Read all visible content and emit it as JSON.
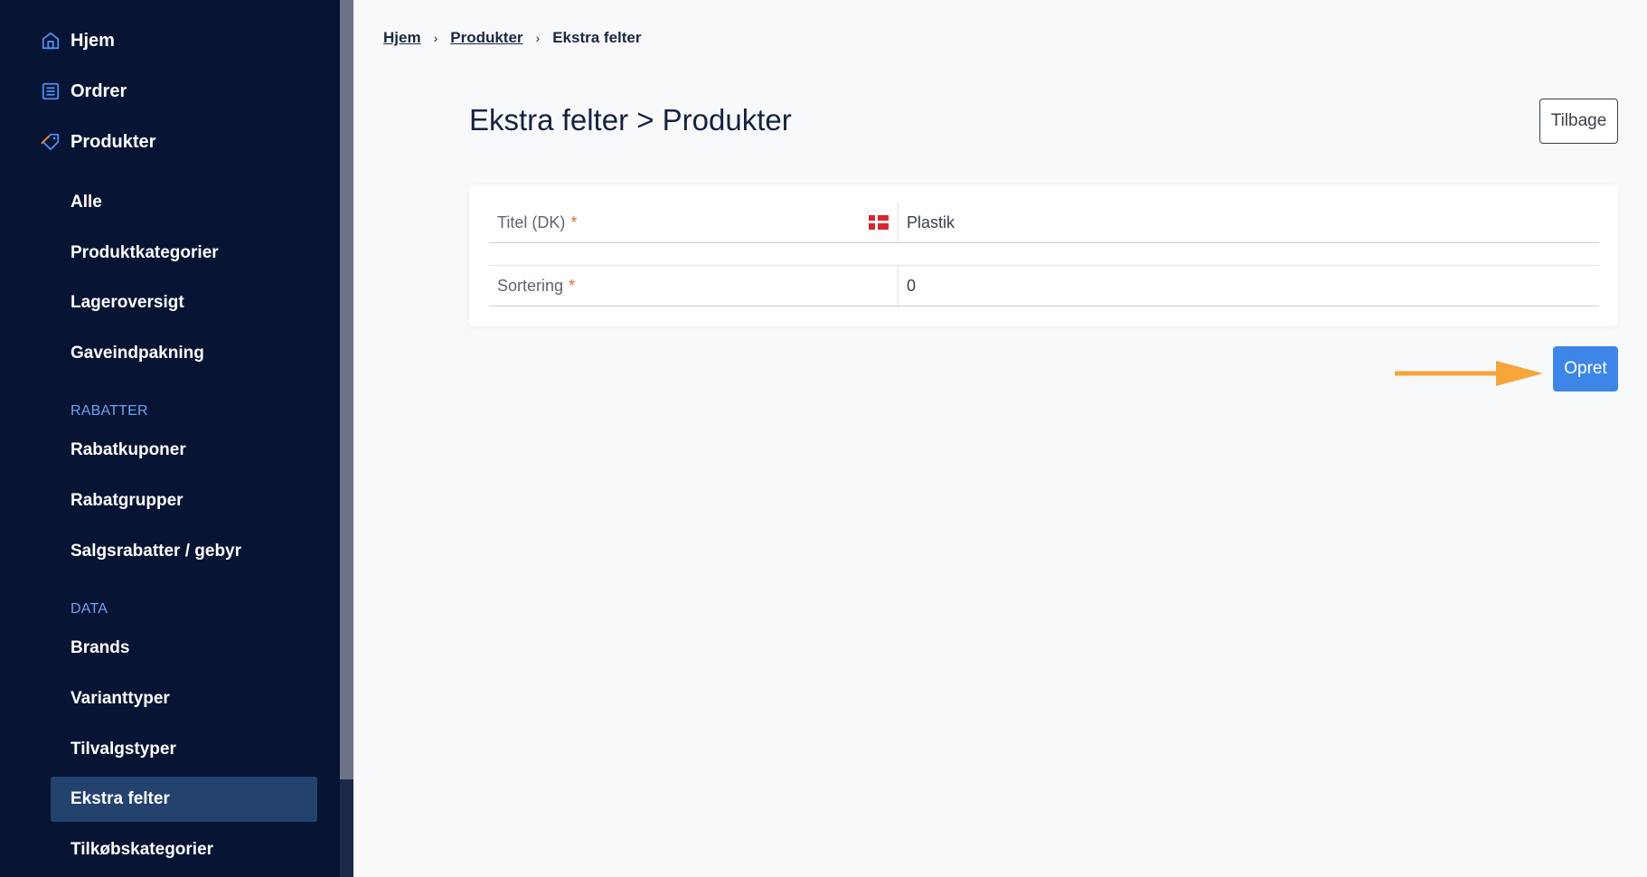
{
  "sidebar": {
    "main_items": [
      {
        "label": "Hjem",
        "icon": "home-icon"
      },
      {
        "label": "Ordrer",
        "icon": "orders-icon"
      },
      {
        "label": "Produkter",
        "icon": "tag-icon"
      }
    ],
    "product_items": [
      "Alle",
      "Produktkategorier",
      "Lageroversigt",
      "Gaveindpakning"
    ],
    "sections": {
      "rabatter": {
        "title": "RABATTER",
        "items": [
          "Rabatkuponer",
          "Rabatgrupper",
          "Salgsrabatter / gebyr"
        ]
      },
      "data": {
        "title": "DATA",
        "items": [
          "Brands",
          "Varianttyper",
          "Tilvalgstyper",
          "Ekstra felter",
          "Tilkøbskategorier"
        ]
      }
    },
    "active_item": "Ekstra felter"
  },
  "breadcrumb": [
    {
      "label": "Hjem",
      "link": true
    },
    {
      "label": "Produkter",
      "link": true
    },
    {
      "label": "Ekstra felter",
      "link": false
    }
  ],
  "page": {
    "title": "Ekstra felter > Produkter",
    "back_label": "Tilbage",
    "create_label": "Opret"
  },
  "form": {
    "title_field": {
      "label": "Titel (DK)",
      "required_mark": "*",
      "value": "Plastik",
      "flag": "denmark-flag-icon"
    },
    "sort_field": {
      "label": "Sortering",
      "required_mark": "*",
      "value": "0"
    }
  },
  "colors": {
    "sidebar_bg": "#071433",
    "accent": "#3d86e8",
    "section_label": "#6ea3f5",
    "active_bg": "#23426d",
    "arrow": "#f5a53a",
    "required": "#e06b3a"
  }
}
